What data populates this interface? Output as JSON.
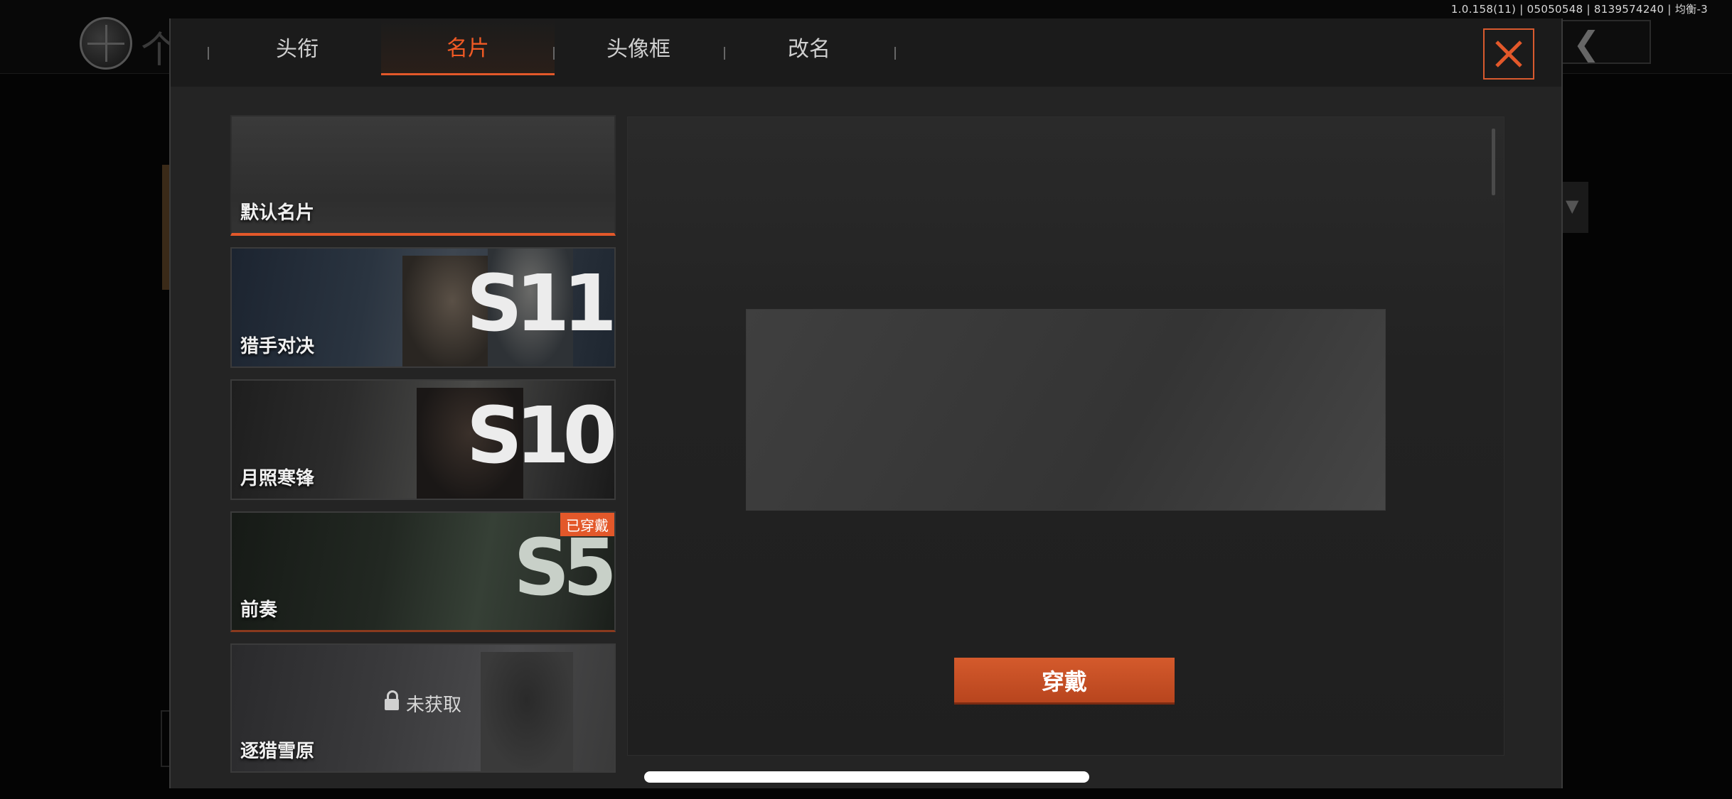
{
  "status_bar": {
    "version_text": "1.0.158(11) | 05050548 | 8139574240 | 均衡-3"
  },
  "background": {
    "title_char": "个",
    "back_icon": "chevron-left-icon"
  },
  "tabs": [
    {
      "label": "头衔",
      "active": false
    },
    {
      "label": "名片",
      "active": true
    },
    {
      "label": "头像框",
      "active": false
    },
    {
      "label": "改名",
      "active": false
    }
  ],
  "close_icon": "close-icon",
  "cards": [
    {
      "label": "默认名片",
      "selected": true
    },
    {
      "label": "猎手对决",
      "season": "S11"
    },
    {
      "label": "月照寒锋",
      "season": "S10"
    },
    {
      "label": "前奏",
      "season": "S5",
      "badge": "已穿戴"
    },
    {
      "label": "逐猎雪原",
      "locked_text": "未获取",
      "lock_icon": "lock-icon"
    }
  ],
  "equip_button_label": "穿戴",
  "colors": {
    "accent": "#e3582a",
    "panel": "#242424",
    "header": "#1b1b1b"
  }
}
